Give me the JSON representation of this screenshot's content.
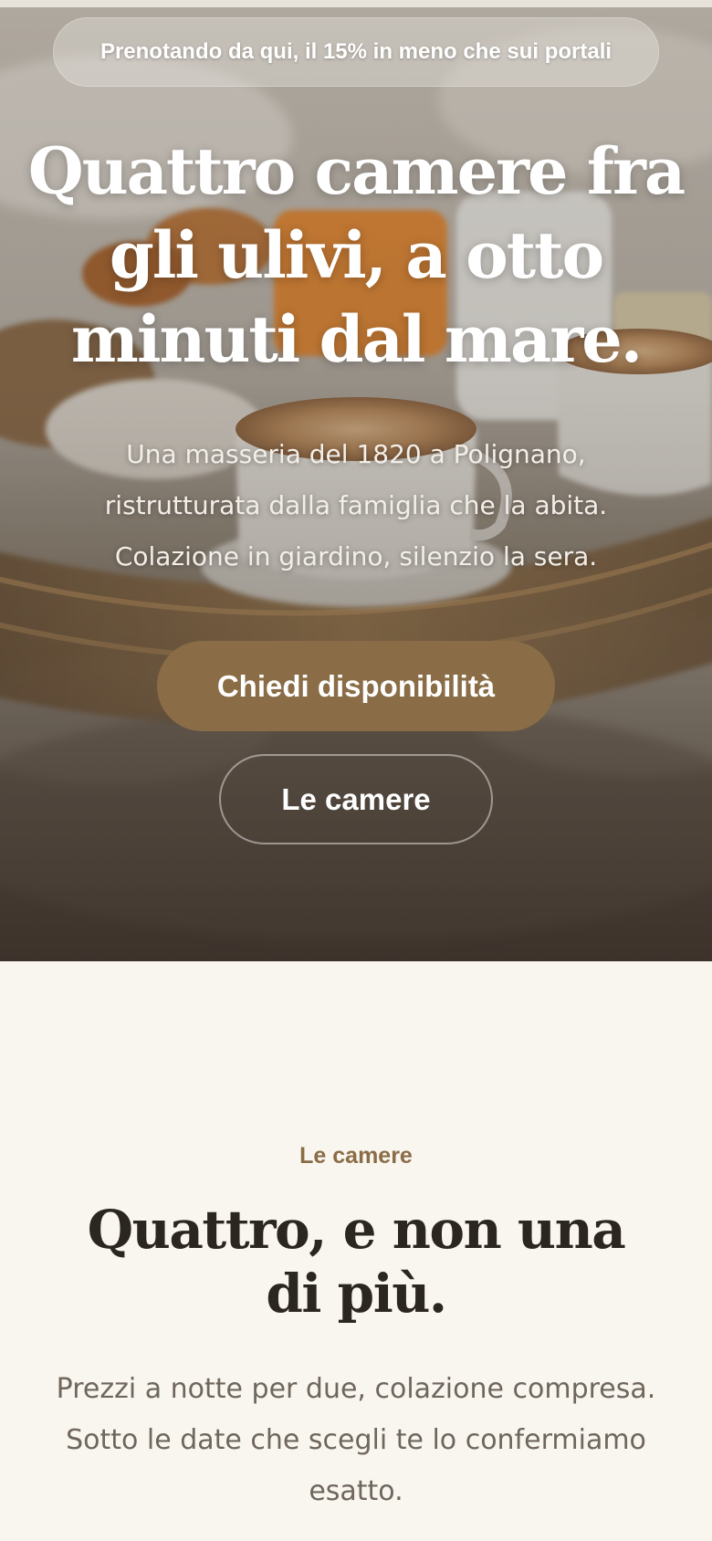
{
  "hero": {
    "promo": "Prenotando da qui, il 15% in meno che sui portali",
    "title": "Quattro camere fra gli ulivi, a otto minuti dal mare.",
    "subtitle": "Una masseria del 1820 a Polignano, ristrutturata dalla famiglia che la abita. Colazione in giardino, silenzio la sera.",
    "primary_cta": "Chiedi disponibilità",
    "secondary_cta": "Le camere"
  },
  "rooms": {
    "eyebrow": "Le camere",
    "title": "Quattro, e non una di più.",
    "description": "Prezzi a notte per due, colazione compresa. Sotto le date che scegli te lo confermiamo esatto."
  },
  "colors": {
    "accent": "#8a6d46",
    "page_background": "#f9f6f0",
    "heading_dark": "#2b2620",
    "body_muted": "#6f665c"
  }
}
